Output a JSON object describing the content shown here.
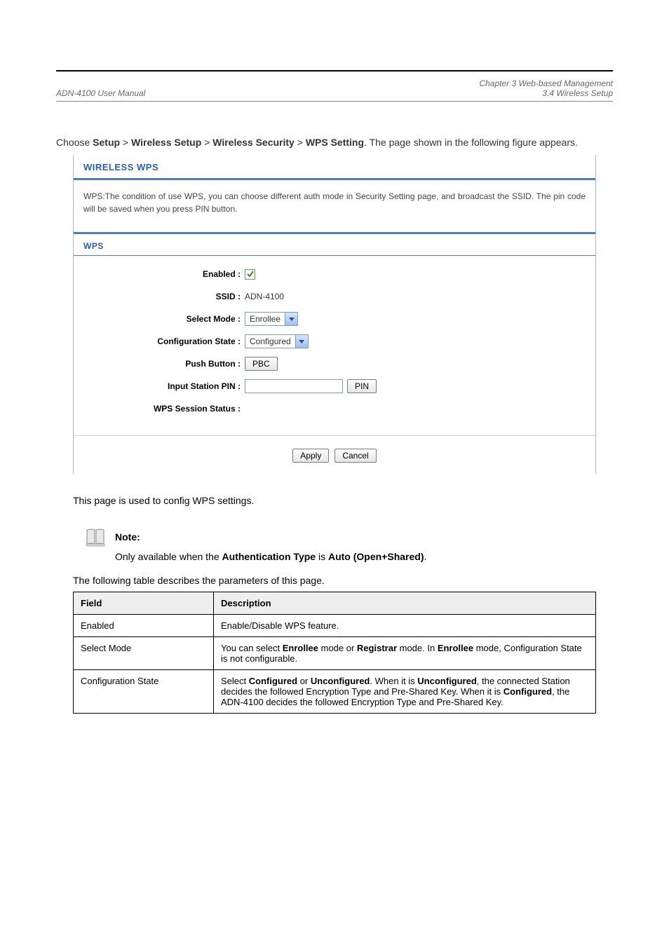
{
  "header": {
    "left": "ADN-4100 User Manual",
    "right_line1": "Chapter 3 Web-based Management",
    "right_line2": "3.4 Wireless Setup"
  },
  "intro": "Choose Setup > Wireless Setup > Wireless Security > WPS Setting. The page shown in the following figure appears.",
  "panel": {
    "title": "WIRELESS WPS",
    "description": "WPS:The condition of use WPS, you can choose different auth mode in Security Setting page, and broadcast the SSID. The pin code will be saved when you press PIN button.",
    "section": "WPS",
    "labels": {
      "enabled": "Enabled :",
      "ssid": "SSID :",
      "select_mode": "Select Mode :",
      "config_state": "Configuration State :",
      "push_button": "Push Button :",
      "input_pin": "Input Station PIN :",
      "session_status": "WPS Session Status :"
    },
    "values": {
      "enabled_checked": true,
      "ssid": "ADN-4100",
      "select_mode": "Enrollee",
      "config_state": "Configured",
      "pbc_btn": "PBC",
      "pin_btn": "PIN",
      "session_status": ""
    },
    "buttons": {
      "apply": "Apply",
      "cancel": "Cancel"
    }
  },
  "description_paragraph": "This page is used to config WPS settings.",
  "note": {
    "label": "Note:",
    "text": "Only available when the Authentication Type is Auto (Open+Shared)."
  },
  "table_intro": "The following table describes the parameters of this page.",
  "table": {
    "headers": {
      "field": "Field",
      "description": "Description"
    },
    "rows": [
      {
        "field": "Enabled",
        "description": "Enable/Disable WPS feature."
      },
      {
        "field": "Select Mode",
        "description": "You can select Enrollee mode or Registrar mode. In Enrollee mode, Configuration State is not configurable."
      },
      {
        "field": "Configuration State",
        "description": "Select Configured or Unconfigured. When it is Unconfigured, the connected Station decides the followed Encryption Type and Pre-Shared Key. When it is Configured, the ADN-4100 decides the followed Encryption Type and Pre-Shared Key."
      }
    ]
  }
}
